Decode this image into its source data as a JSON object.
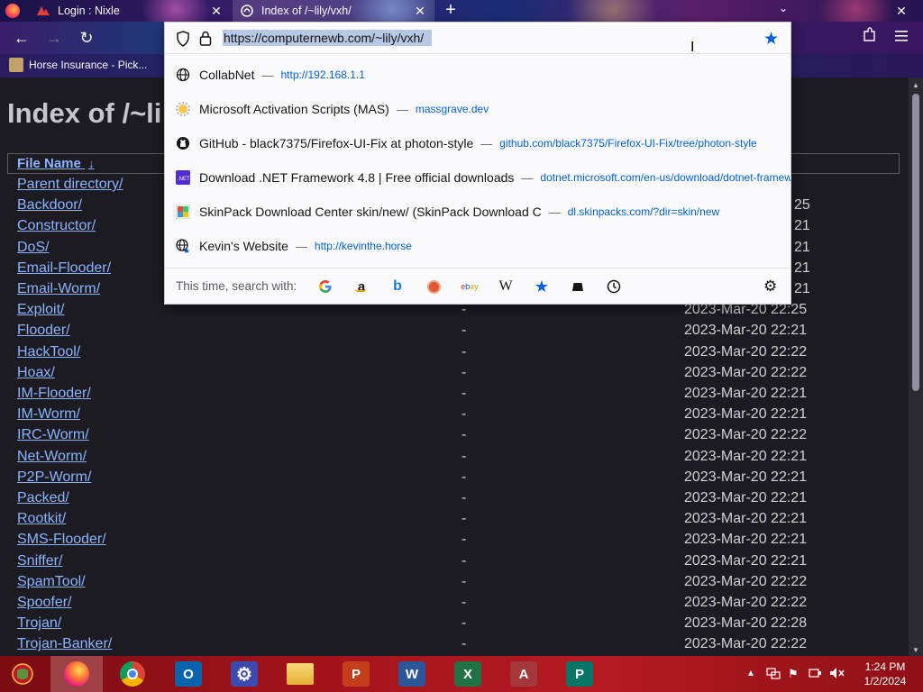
{
  "browser": {
    "tabs": [
      {
        "label": "Login : Nixle",
        "active": false
      },
      {
        "label": "Index of /~lily/vxh/",
        "active": true
      }
    ],
    "bookmarks_bar": [
      {
        "label": "Horse Insurance - Pick..."
      }
    ]
  },
  "urlbar": {
    "value": "https://computernewb.com/~lily/vxh/"
  },
  "suggestions": [
    {
      "title": "CollabNet",
      "url": "http://192.168.1.1",
      "icon": "globe-icon"
    },
    {
      "title": "Microsoft Activation Scripts (MAS)",
      "url": "massgrave.dev",
      "icon": "mas-favicon"
    },
    {
      "title": "GitHub - black7375/Firefox-UI-Fix at photon-style",
      "url": "github.com/black7375/Firefox-UI-Fix/tree/photon-style",
      "icon": "github-icon"
    },
    {
      "title": "Download .NET Framework 4.8 | Free official downloads",
      "url": "dotnet.microsoft.com/en-us/download/dotnet-framework",
      "icon": "dotnet-icon"
    },
    {
      "title": "SkinPack Download Center skin/new/ (SkinPack Download C",
      "url": "dl.skinpacks.com/?dir=skin/new",
      "icon": "skinpack-icon"
    },
    {
      "title": "Kevin's Website",
      "url": "http://kevinthe.horse",
      "icon": "globe-bookmark-icon"
    }
  ],
  "search_with": {
    "label": "This time, search with:",
    "engines": [
      "google",
      "amazon",
      "bing",
      "duckduckgo",
      "ebay",
      "wikipedia",
      "bookmarks",
      "tabs",
      "history"
    ]
  },
  "page": {
    "title": "Index of /~li",
    "column_name": "File Name",
    "sort_indicator": "↓",
    "rows": [
      {
        "name": "Parent directory/",
        "size": "",
        "date": ""
      },
      {
        "name": "Backdoor/",
        "size": "",
        "date": "25"
      },
      {
        "name": "Constructor/",
        "size": "",
        "date": "21"
      },
      {
        "name": "DoS/",
        "size": "",
        "date": "21"
      },
      {
        "name": "Email-Flooder/",
        "size": "",
        "date": "21"
      },
      {
        "name": "Email-Worm/",
        "size": "",
        "date": "21"
      },
      {
        "name": "Exploit/",
        "size": "-",
        "date": "2023-Mar-20 22:25"
      },
      {
        "name": "Flooder/",
        "size": "-",
        "date": "2023-Mar-20 22:21"
      },
      {
        "name": "HackTool/",
        "size": "-",
        "date": "2023-Mar-20 22:22"
      },
      {
        "name": "Hoax/",
        "size": "-",
        "date": "2023-Mar-20 22:22"
      },
      {
        "name": "IM-Flooder/",
        "size": "-",
        "date": "2023-Mar-20 22:21"
      },
      {
        "name": "IM-Worm/",
        "size": "-",
        "date": "2023-Mar-20 22:21"
      },
      {
        "name": "IRC-Worm/",
        "size": "-",
        "date": "2023-Mar-20 22:22"
      },
      {
        "name": "Net-Worm/",
        "size": "-",
        "date": "2023-Mar-20 22:21"
      },
      {
        "name": "P2P-Worm/",
        "size": "-",
        "date": "2023-Mar-20 22:21"
      },
      {
        "name": "Packed/",
        "size": "-",
        "date": "2023-Mar-20 22:21"
      },
      {
        "name": "Rootkit/",
        "size": "-",
        "date": "2023-Mar-20 22:21"
      },
      {
        "name": "SMS-Flooder/",
        "size": "-",
        "date": "2023-Mar-20 22:21"
      },
      {
        "name": "Sniffer/",
        "size": "-",
        "date": "2023-Mar-20 22:21"
      },
      {
        "name": "SpamTool/",
        "size": "-",
        "date": "2023-Mar-20 22:22"
      },
      {
        "name": "Spoofer/",
        "size": "-",
        "date": "2023-Mar-20 22:22"
      },
      {
        "name": "Trojan/",
        "size": "-",
        "date": "2023-Mar-20 22:28"
      },
      {
        "name": "Trojan-Banker/",
        "size": "-",
        "date": "2023-Mar-20 22:22"
      }
    ]
  },
  "taskbar": {
    "apps": [
      "start",
      "firefox",
      "chrome",
      "outlook",
      "settings",
      "file-explorer",
      "powerpoint",
      "word",
      "excel",
      "access",
      "publisher"
    ],
    "tiles": {
      "outlook": "O",
      "powerpoint": "P",
      "word": "W",
      "excel": "X",
      "access": "A",
      "publisher": "P"
    },
    "clock_time": "1:24 PM",
    "clock_date": "1/2/2024"
  },
  "colors": {
    "link": "#8ab4ff",
    "accent": "#0061e0",
    "page_bg": "#1c1b22",
    "taskbar": "#a4141c"
  }
}
